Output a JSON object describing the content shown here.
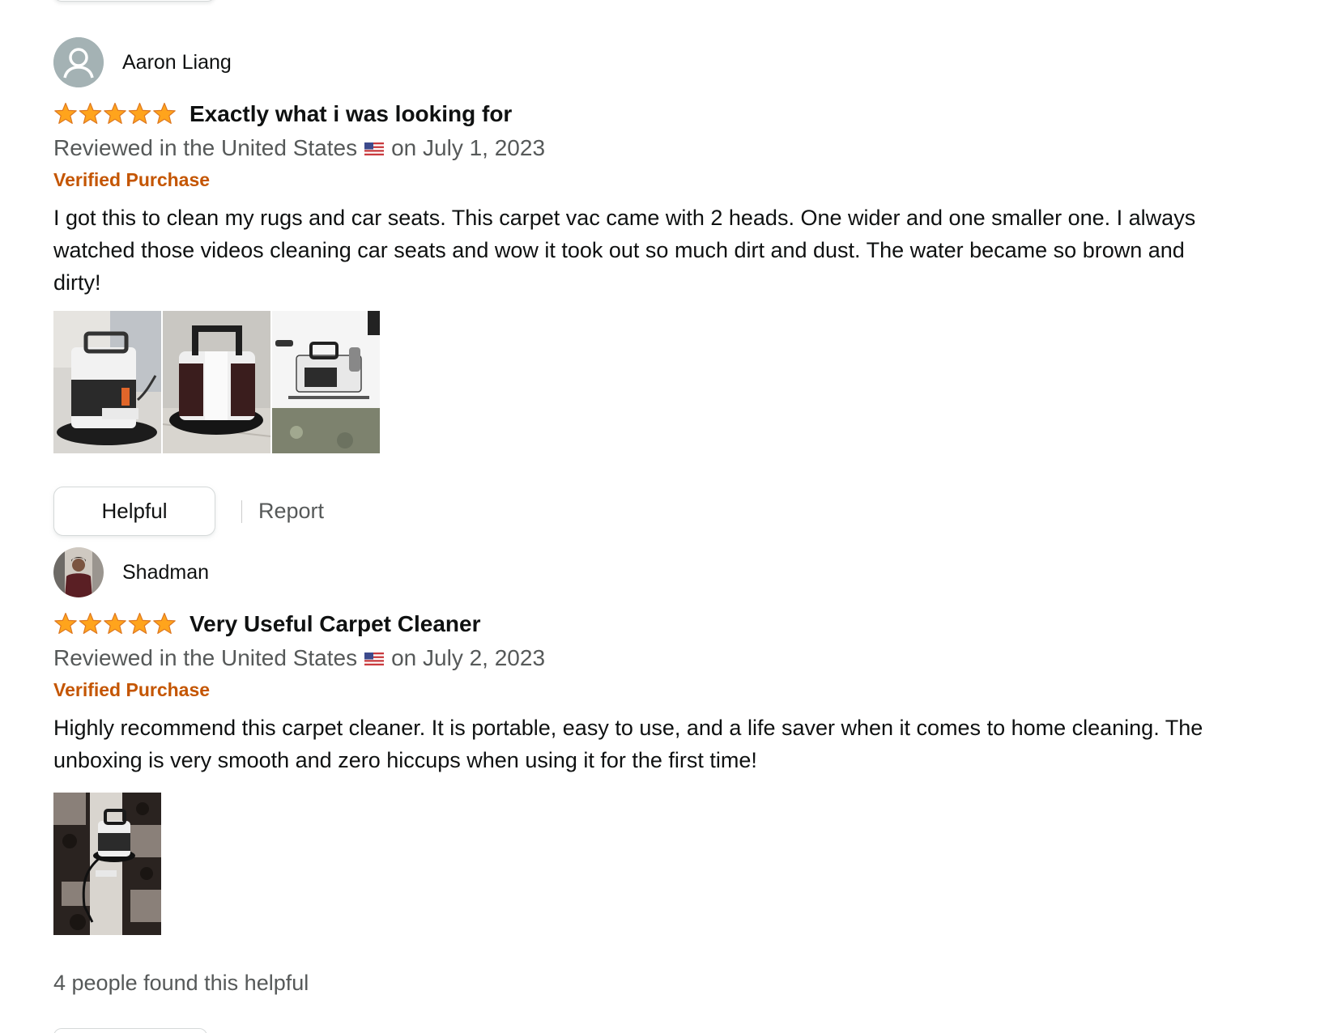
{
  "reviews": [
    {
      "profile_name": "Aaron Liang",
      "rating": 5,
      "title": "Exactly what i was looking for",
      "date_prefix": "Reviewed in the United States",
      "date_suffix": "on July 1, 2023",
      "verified": "Verified Purchase",
      "body": "I got this to clean my rugs and car seats. This carpet vac came with 2 heads. One wider and one smaller one. I always watched those videos cleaning car seats and wow it took out so much dirt and dust. The water became so brown and dirty!",
      "image_count": 3,
      "helpful_label": "Helpful",
      "report_label": "Report"
    },
    {
      "profile_name": "Shadman",
      "rating": 5,
      "title": "Very Useful Carpet Cleaner",
      "date_prefix": "Reviewed in the United States",
      "date_suffix": "on July 2, 2023",
      "verified": "Verified Purchase",
      "body": "Highly recommend this carpet cleaner. It is portable, easy to use, and a life saver when it comes to home cleaning. The unboxing is very smooth and zero hiccups when using it for the first time!",
      "image_count": 1,
      "helpful_count_text": "4 people found this helpful"
    }
  ],
  "colors": {
    "star": "#ffa41c",
    "verified": "#c45500",
    "secondary_text": "#565959",
    "primary_text": "#0f1111"
  },
  "icons": {
    "avatar_default": "person-silhouette-icon",
    "star": "star-icon",
    "flag": "us-flag-icon"
  }
}
